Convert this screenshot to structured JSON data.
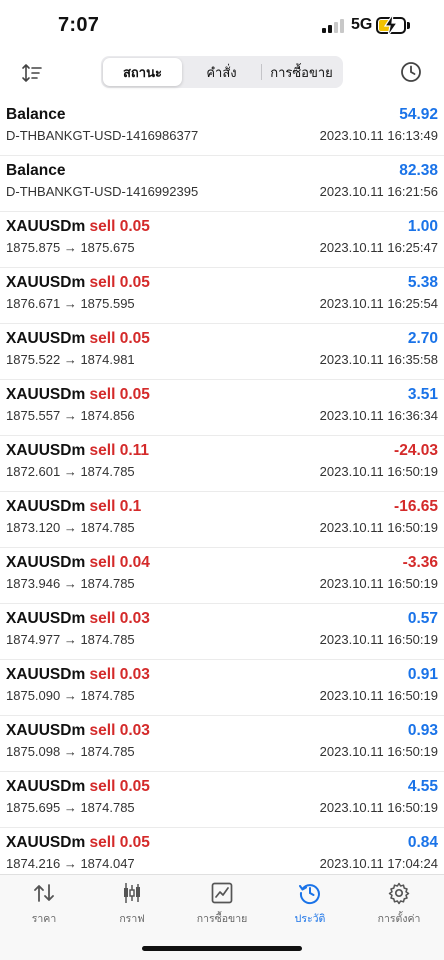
{
  "status_bar": {
    "time": "7:07",
    "network": "5G"
  },
  "toolbar": {
    "tabs": [
      {
        "label": "สถานะ",
        "active": true
      },
      {
        "label": "คำสั่ง",
        "active": false
      },
      {
        "label": "การซื้อขาย",
        "active": false
      }
    ],
    "left_icon": "sort-icon",
    "right_icon": "clock-icon"
  },
  "colors": {
    "accent": "#1a73e8",
    "negative": "#d42a2a",
    "battery": "#f2c200"
  },
  "history": [
    {
      "title": "Balance",
      "side": "",
      "volume": "",
      "detail": "D-THBANKGT-USD-1416986377",
      "value": "54.92",
      "sign": "pos",
      "time": "2023.10.11 16:13:49"
    },
    {
      "title": "Balance",
      "side": "",
      "volume": "",
      "detail": "D-THBANKGT-USD-1416992395",
      "value": "82.38",
      "sign": "pos",
      "time": "2023.10.11 16:21:56"
    },
    {
      "title": "XAUUSDm",
      "side": "sell",
      "volume": "0.05",
      "detail": "1875.875 → 1875.675",
      "value": "1.00",
      "sign": "pos",
      "time": "2023.10.11 16:25:47"
    },
    {
      "title": "XAUUSDm",
      "side": "sell",
      "volume": "0.05",
      "detail": "1876.671 → 1875.595",
      "value": "5.38",
      "sign": "pos",
      "time": "2023.10.11 16:25:54"
    },
    {
      "title": "XAUUSDm",
      "side": "sell",
      "volume": "0.05",
      "detail": "1875.522 → 1874.981",
      "value": "2.70",
      "sign": "pos",
      "time": "2023.10.11 16:35:58"
    },
    {
      "title": "XAUUSDm",
      "side": "sell",
      "volume": "0.05",
      "detail": "1875.557 → 1874.856",
      "value": "3.51",
      "sign": "pos",
      "time": "2023.10.11 16:36:34"
    },
    {
      "title": "XAUUSDm",
      "side": "sell",
      "volume": "0.11",
      "detail": "1872.601 → 1874.785",
      "value": "-24.03",
      "sign": "neg",
      "time": "2023.10.11 16:50:19"
    },
    {
      "title": "XAUUSDm",
      "side": "sell",
      "volume": "0.1",
      "detail": "1873.120 → 1874.785",
      "value": "-16.65",
      "sign": "neg",
      "time": "2023.10.11 16:50:19"
    },
    {
      "title": "XAUUSDm",
      "side": "sell",
      "volume": "0.04",
      "detail": "1873.946 → 1874.785",
      "value": "-3.36",
      "sign": "neg",
      "time": "2023.10.11 16:50:19"
    },
    {
      "title": "XAUUSDm",
      "side": "sell",
      "volume": "0.03",
      "detail": "1874.977 → 1874.785",
      "value": "0.57",
      "sign": "pos",
      "time": "2023.10.11 16:50:19"
    },
    {
      "title": "XAUUSDm",
      "side": "sell",
      "volume": "0.03",
      "detail": "1875.090 → 1874.785",
      "value": "0.91",
      "sign": "pos",
      "time": "2023.10.11 16:50:19"
    },
    {
      "title": "XAUUSDm",
      "side": "sell",
      "volume": "0.03",
      "detail": "1875.098 → 1874.785",
      "value": "0.93",
      "sign": "pos",
      "time": "2023.10.11 16:50:19"
    },
    {
      "title": "XAUUSDm",
      "side": "sell",
      "volume": "0.05",
      "detail": "1875.695 → 1874.785",
      "value": "4.55",
      "sign": "pos",
      "time": "2023.10.11 16:50:19"
    },
    {
      "title": "XAUUSDm",
      "side": "sell",
      "volume": "0.05",
      "detail": "1874.216 → 1874.047",
      "value": "0.84",
      "sign": "pos",
      "time": "2023.10.11 17:04:24"
    }
  ],
  "bottom_nav": [
    {
      "label": "ราคา",
      "icon": "quotes-icon",
      "active": false
    },
    {
      "label": "กราฟ",
      "icon": "chart-icon",
      "active": false
    },
    {
      "label": "การซื้อขาย",
      "icon": "trade-icon",
      "active": false
    },
    {
      "label": "ประวัติ",
      "icon": "history-icon",
      "active": true
    },
    {
      "label": "การตั้งค่า",
      "icon": "settings-icon",
      "active": false
    }
  ]
}
